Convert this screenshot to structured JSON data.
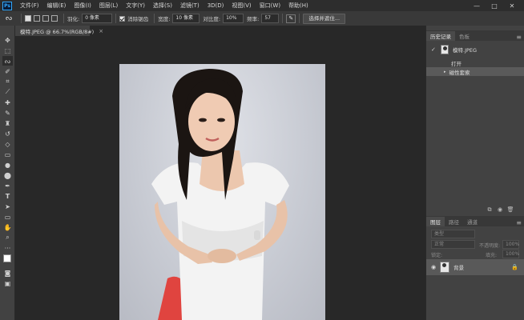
{
  "app": {
    "logo": "Ps"
  },
  "menu": [
    "文件(F)",
    "编辑(E)",
    "图像(I)",
    "图层(L)",
    "文字(Y)",
    "选择(S)",
    "滤镜(T)",
    "3D(D)",
    "视图(V)",
    "窗口(W)",
    "帮助(H)"
  ],
  "window_controls": {
    "minimize": "—",
    "restore": "□",
    "close": "✕"
  },
  "options": {
    "feather_label": "羽化:",
    "feather_value": "0 像素",
    "antialias_label": "消除锯齿",
    "width_label": "宽度:",
    "width_value": "10 像素",
    "contrast_label": "对比度:",
    "contrast_value": "10%",
    "frequency_label": "频率:",
    "frequency_value": "57",
    "select_mask_button": "选择并遮住..."
  },
  "document": {
    "tab_title": "模特.JPEG @ 66.7%(RGB/8#)",
    "tab_close": "×"
  },
  "history_panel": {
    "tabs": [
      "历史记录",
      "色板"
    ],
    "snapshot_name": "模特.JPEG",
    "states": [
      "打开",
      "磁性套索"
    ]
  },
  "layers_panel": {
    "tabs": [
      "图层",
      "路径",
      "通道"
    ],
    "kind_placeholder": "类型",
    "blend_mode": "正常",
    "opacity_label": "不透明度:",
    "opacity_value": "100%",
    "lock_label": "锁定:",
    "fill_label": "填充:",
    "fill_value": "100%",
    "layers": [
      {
        "name": "背景"
      }
    ]
  },
  "icons": {
    "tools": [
      "move-icon",
      "marquee-icon",
      "lasso-icon",
      "quick-select-icon",
      "crop-icon",
      "eyedropper-icon",
      "healing-brush-icon",
      "brush-icon",
      "clone-stamp-icon",
      "history-brush-icon",
      "eraser-icon",
      "gradient-icon",
      "blur-icon",
      "dodge-icon",
      "pen-icon",
      "type-icon",
      "path-select-icon",
      "rectangle-icon",
      "hand-icon",
      "zoom-icon",
      "more-icon",
      "color-swatch-icon",
      "quick-mask-icon",
      "screen-mode-icon"
    ]
  }
}
